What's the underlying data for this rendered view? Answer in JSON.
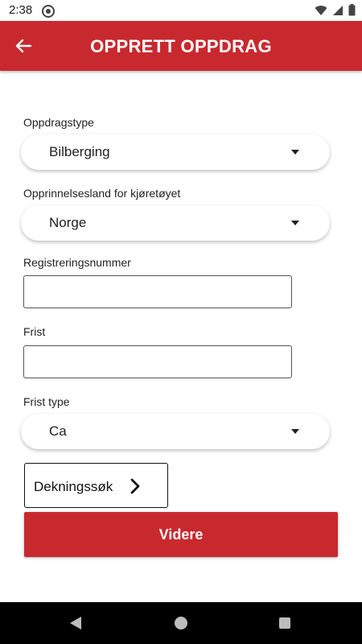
{
  "status_bar": {
    "time": "2:38"
  },
  "app_bar": {
    "title": "OPPRETT OPPDRAG"
  },
  "form": {
    "assignment_type": {
      "label": "Oppdragstype",
      "value": "Bilberging"
    },
    "origin_country": {
      "label": "Opprinnelsesland for kjøretøyet",
      "value": "Norge"
    },
    "registration_number": {
      "label": "Registreringsnummer",
      "value": ""
    },
    "deadline": {
      "label": "Frist",
      "value": ""
    },
    "deadline_type": {
      "label": "Frist type",
      "value": "Ca"
    }
  },
  "coverage_search": {
    "label": "Dekningssøk"
  },
  "continue_button": {
    "label": "Videre"
  },
  "colors": {
    "brand": "#c8292f",
    "nav_bar": "#000000"
  },
  "icons": {
    "back": "arrow-left-icon",
    "chevron": "chevron-right-icon",
    "dropdown": "caret-down-icon",
    "wifi": "wifi-icon",
    "signal": "signal-icon",
    "battery": "battery-icon"
  }
}
